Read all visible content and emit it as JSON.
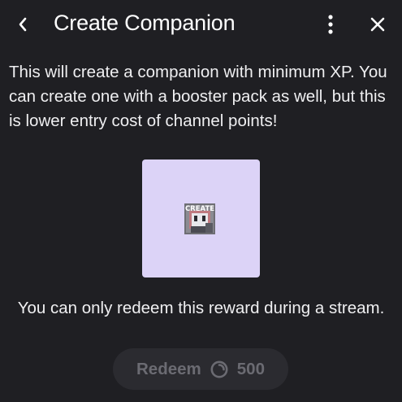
{
  "header": {
    "title": "Create Companion",
    "back_icon": "chevron-left-icon",
    "more_icon": "more-vertical-icon",
    "close_icon": "close-icon"
  },
  "description": "This will create a companion with minimum XP. You can create one with a booster pack as well, but this is lower entry cost of channel points!",
  "reward": {
    "image_label": "CREATE",
    "background": "#dcd3f7"
  },
  "note": "You can only redeem this reward during a stream.",
  "redeem": {
    "label": "Redeem",
    "cost": "500",
    "cost_icon": "channel-points-icon",
    "state": "disabled"
  },
  "colors": {
    "background": "#1f1f23",
    "text": "#efeff1",
    "button_bg": "#2b2b30",
    "button_text": "#6b6b72"
  }
}
